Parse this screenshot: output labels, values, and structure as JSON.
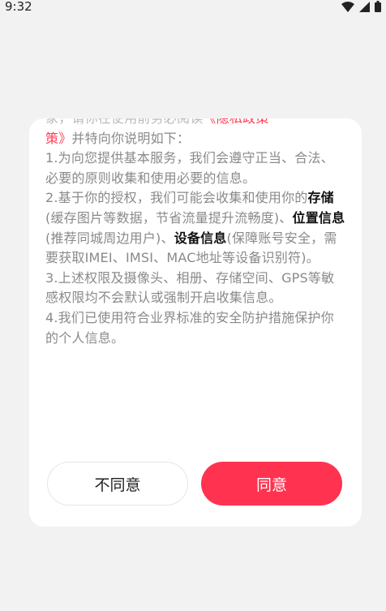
{
  "status_bar": {
    "time": "9:32",
    "icons": [
      "wifi-icon",
      "signal-icon",
      "battery-icon"
    ]
  },
  "dialog": {
    "top_line": {
      "pre": "家，请你在使用前务必阅读",
      "link": "《隐私政策"
    },
    "line1": {
      "link": "策》",
      "text": "并特向你说明如下："
    },
    "item1": "1.为向您提供基本服务，我们会遵守正当、合法、必要的原则收集和使用必要的信息。",
    "item2": {
      "pre": "2.基于你的授权，我们可能会收集和使用你的",
      "bold_storage": "存储",
      "after_storage": "(缓存图片等数据，节省流量提升流畅度)、",
      "bold_location": "位置信息",
      "after_location": "(推荐同城周边用户)、",
      "bold_device": "设备信息",
      "after_device": "(保障账号安全，需要获取IMEI、IMSI、MAC地址等设备识别符)。"
    },
    "item3": "3.上述权限及摄像头、相册、存储空间、GPS等敏感权限均不会默认或强制开启收集信息。",
    "item4": "4.我们已使用符合业界标准的安全防护措施保护你的个人信息。",
    "disagree_label": "不同意",
    "agree_label": "同意"
  },
  "colors": {
    "accent": "#ff3350",
    "link": "#ff3d55",
    "text_gray": "#8a8a8a",
    "background": "#f2f2f2"
  }
}
